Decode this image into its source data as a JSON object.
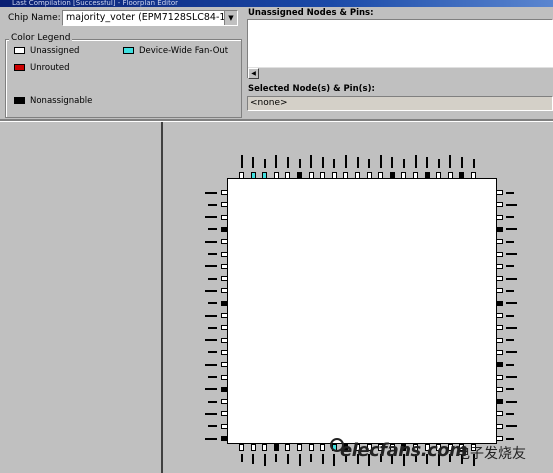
{
  "window": {
    "title": "Last Compilation [Successful] - Floorplan Editor"
  },
  "chip": {
    "label": "Chip Name:",
    "value": "majority_voter (EPM7128SLC84-15)"
  },
  "legend": {
    "title": "Color Legend",
    "items": [
      {
        "label": "Unassigned",
        "color": "#ffffff"
      },
      {
        "label": "Device-Wide Fan-Out",
        "color": "#40e0e0"
      },
      {
        "label": "Unrouted",
        "color": "#cc0000"
      },
      {
        "label": "Nonassignable",
        "color": "#000000"
      }
    ]
  },
  "unassigned": {
    "title": "Unassigned Nodes & Pins:"
  },
  "selected": {
    "title": "Selected Node(s) & Pin(s):",
    "value": "<none>"
  },
  "watermark": {
    "text": "elecfans.com",
    "cn": "电子发烧友"
  }
}
